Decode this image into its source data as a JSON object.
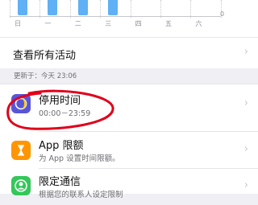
{
  "chart": {
    "y_zero_label": "0",
    "days": [
      "日",
      "一",
      "二",
      "三",
      "四",
      "五",
      "六"
    ]
  },
  "chart_data": {
    "type": "bar",
    "categories": [
      "日",
      "一",
      "二",
      "三",
      "四",
      "五",
      "六"
    ],
    "series": [
      {
        "values": [
          1,
          1,
          1,
          1,
          0,
          0,
          0
        ]
      }
    ],
    "ylim": [
      0,
      1
    ]
  },
  "see_all": {
    "label": "查看所有活动"
  },
  "updated_text": "更新于：今天 23:06",
  "items": [
    {
      "title": "停用时间",
      "subtitle": "00:00－23:59",
      "icon": "downtime-moon-icon",
      "color": "#5856d6"
    },
    {
      "title": "App 限额",
      "subtitle": "为 App 设置时间限额。",
      "icon": "hourglass-icon",
      "color": "#ff9500"
    },
    {
      "title": "限定通信",
      "subtitle": "根据您的联系人设定限制",
      "icon": "person-circle-icon",
      "color": "#34c759"
    }
  ],
  "annotation": {
    "color": "#e0001a"
  }
}
